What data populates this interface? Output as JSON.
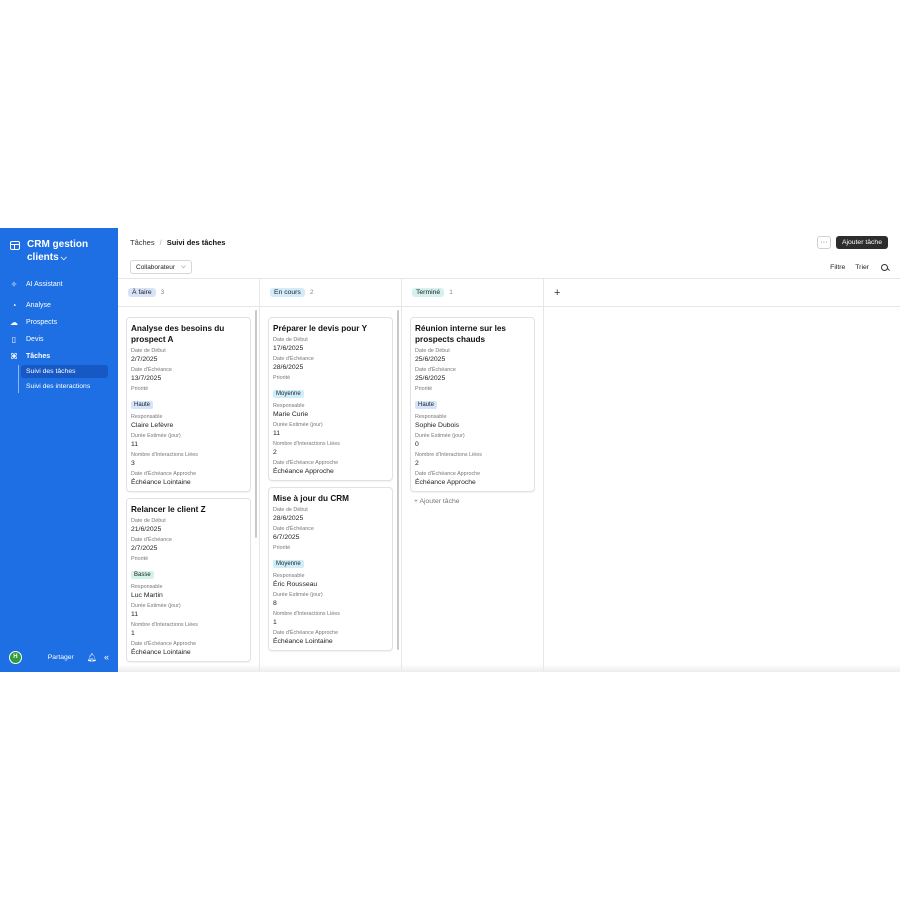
{
  "sidebar": {
    "brand": "CRM gestion clients",
    "items": [
      {
        "label": "AI Assistant",
        "icon": "sparkle-icon"
      },
      {
        "label": "Analyse",
        "icon": "analytics-icon"
      },
      {
        "label": "Prospects",
        "icon": "cloud-icon"
      },
      {
        "label": "Devis",
        "icon": "document-icon"
      },
      {
        "label": "Tâches",
        "icon": "tasks-icon"
      }
    ],
    "subitems": [
      {
        "label": "Suivi des tâches",
        "active": true
      },
      {
        "label": "Suivi des interactions",
        "active": false
      }
    ],
    "footer": {
      "avatar": "H",
      "share": "Partager",
      "bell_icon": "bell-icon",
      "collapse_icon": "double-chevron-left-icon"
    }
  },
  "header": {
    "breadcrumb_root": "Tâches",
    "breadcrumb_current": "Suivi des tâches",
    "more": "···",
    "add_task": "Ajouter tâche"
  },
  "toolbar": {
    "collaborator": "Collaborateur",
    "filter": "Filtre",
    "sort": "Trier"
  },
  "labels": {
    "start": "Date de Début",
    "due": "Date d'Échéance",
    "priority": "Priorité",
    "owner": "Responsable",
    "duration": "Durée Estimée (jour)",
    "interactions": "Nombre d'Interactions Liées",
    "due_status": "Date d'Échéance Approche"
  },
  "columns": [
    {
      "name": "À faire",
      "count": "3",
      "cards": [
        {
          "title": "Analyse des besoins du prospect A",
          "start": "2/7/2025",
          "due": "13/7/2025",
          "priority": "Haute",
          "owner": "Claire Lefèvre",
          "duration": "11",
          "interactions": "3",
          "due_status": "Échéance Lointaine"
        },
        {
          "title": "Relancer le client Z",
          "start": "21/6/2025",
          "due": "2/7/2025",
          "priority": "Basse",
          "owner": "Luc Martin",
          "duration": "11",
          "interactions": "1",
          "due_status": "Échéance Lointaine"
        }
      ]
    },
    {
      "name": "En cours",
      "count": "2",
      "cards": [
        {
          "title": "Préparer le devis pour Y",
          "start": "17/6/2025",
          "due": "28/6/2025",
          "priority": "Moyenne",
          "owner": "Marie Curie",
          "duration": "11",
          "interactions": "2",
          "due_status": "Échéance Approche"
        },
        {
          "title": "Mise à jour du CRM",
          "start": "28/6/2025",
          "due": "6/7/2025",
          "priority": "Moyenne",
          "owner": "Éric Rousseau",
          "duration": "8",
          "interactions": "1",
          "due_status": "Échéance Lointaine"
        }
      ]
    },
    {
      "name": "Terminé",
      "count": "1",
      "cards": [
        {
          "title": "Réunion interne sur les prospects chauds",
          "start": "25/6/2025",
          "due": "25/6/2025",
          "priority": "Haute",
          "owner": "Sophie Dubois",
          "duration": "0",
          "interactions": "2",
          "due_status": "Échéance Approche"
        }
      ],
      "add_inline": "+ Ajouter tâche"
    }
  ],
  "add_column": "+",
  "colors": {
    "sidebar": "#1d6fe3",
    "active_subitem": "#1658c4",
    "button_dark": "#2d2d2d"
  }
}
